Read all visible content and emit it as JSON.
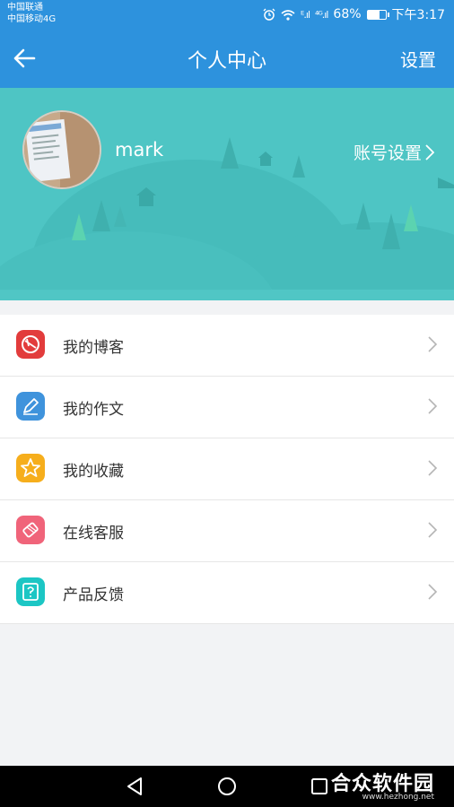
{
  "status": {
    "carrier1": "中国联通",
    "carrier2": "中国移动4G",
    "battery": "68%",
    "battery_level": 0.68,
    "time": "下午3:17",
    "signal1": "ᴱ.ıl",
    "signal2": "⁴ᴳ.ıl"
  },
  "header": {
    "title": "个人中心",
    "settings": "设置"
  },
  "profile": {
    "username": "mark",
    "account_settings": "账号设置"
  },
  "menu": {
    "items": [
      {
        "label": "我的博客",
        "icon": "blog-icon",
        "color": "#e23c3c"
      },
      {
        "label": "我的作文",
        "icon": "pencil-icon",
        "color": "#3f93dc"
      },
      {
        "label": "我的收藏",
        "icon": "star-icon",
        "color": "#f6ae1c"
      },
      {
        "label": "在线客服",
        "icon": "customer-service-icon",
        "color": "#f0647a"
      },
      {
        "label": "产品反馈",
        "icon": "feedback-icon",
        "color": "#1cc6c4"
      }
    ]
  },
  "watermark": {
    "main": "合众软件园",
    "sub": "www.hezhong.net"
  },
  "colors": {
    "primary": "#2d92dd",
    "hero": "#4ec5c4"
  }
}
